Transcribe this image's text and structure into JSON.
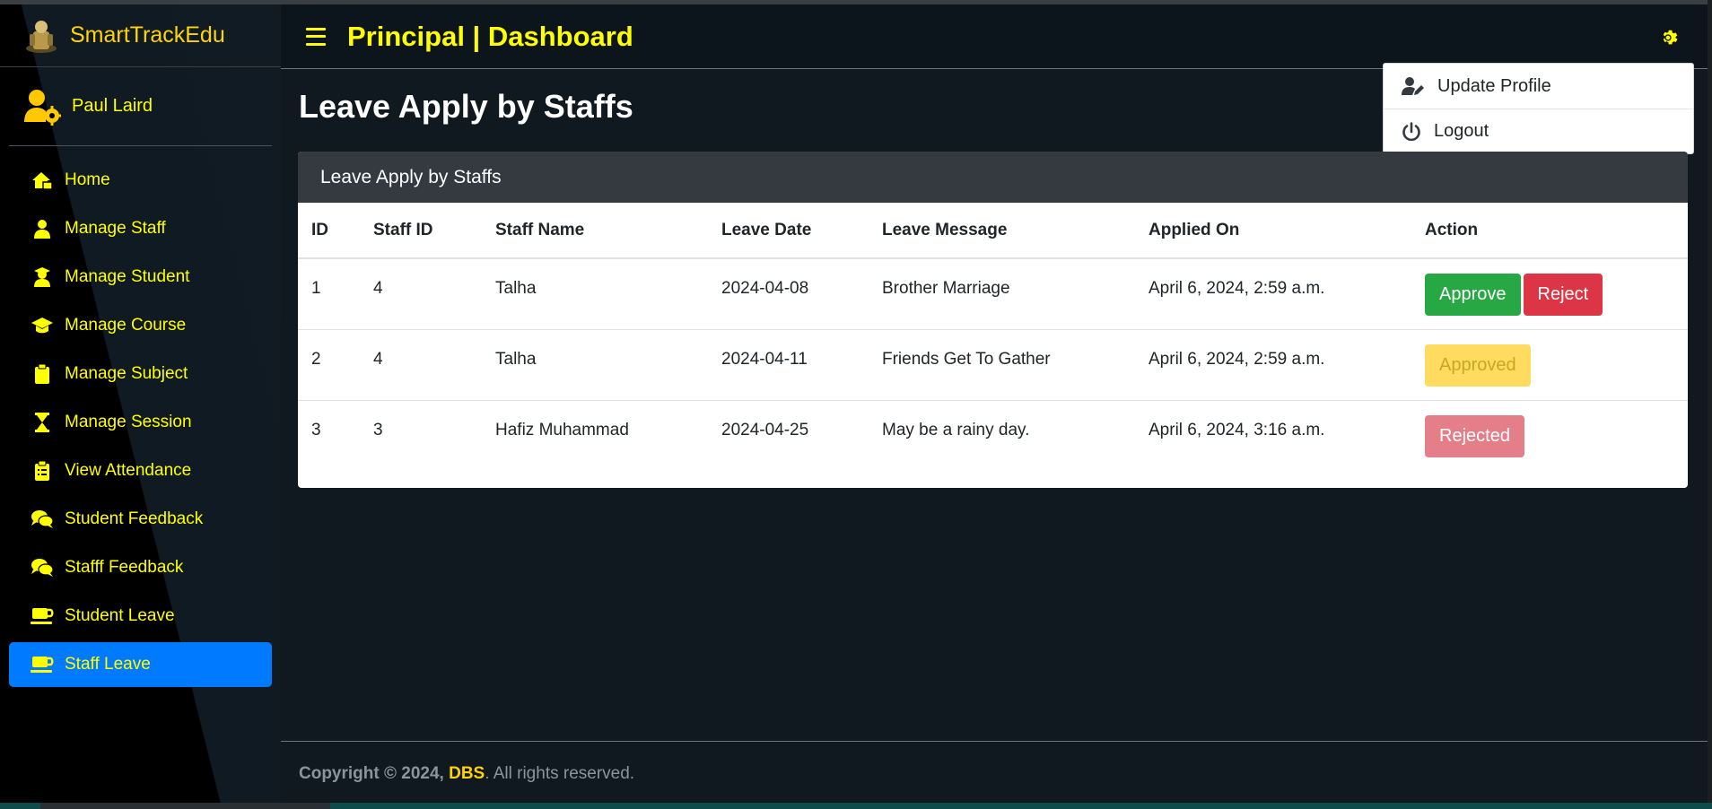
{
  "brand": {
    "name": "SmartTrackEdu"
  },
  "user": {
    "name": "Paul Laird"
  },
  "sidebar": {
    "items": [
      {
        "label": "Home",
        "icon": "home-icon"
      },
      {
        "label": "Manage Staff",
        "icon": "user-icon"
      },
      {
        "label": "Manage Student",
        "icon": "student-icon"
      },
      {
        "label": "Manage Course",
        "icon": "graduation-cap-icon"
      },
      {
        "label": "Manage Subject",
        "icon": "clipboard-icon"
      },
      {
        "label": "Manage Session",
        "icon": "hourglass-icon"
      },
      {
        "label": "View Attendance",
        "icon": "clipboard-list-icon"
      },
      {
        "label": "Student Feedback",
        "icon": "comments-icon"
      },
      {
        "label": "Stafff Feedback",
        "icon": "comments-icon"
      },
      {
        "label": "Student Leave",
        "icon": "coffee-icon"
      },
      {
        "label": "Staff Leave",
        "icon": "coffee-icon",
        "active": true
      }
    ]
  },
  "header": {
    "title": "Principal | Dashboard"
  },
  "dropdown": {
    "update_profile": "Update Profile",
    "logout": "Logout"
  },
  "main": {
    "title": "Leave Apply by Staffs",
    "card_title": "Leave Apply by Staffs",
    "columns": [
      "ID",
      "Staff ID",
      "Staff Name",
      "Leave Date",
      "Leave Message",
      "Applied On",
      "Action"
    ],
    "rows": [
      {
        "id": "1",
        "staff_id": "4",
        "staff_name": "Talha",
        "leave_date": "2024-04-08",
        "message": "Brother Marriage",
        "applied_on": "April 6, 2024, 2:59 a.m.",
        "approve": "Approve",
        "reject": "Reject"
      },
      {
        "id": "2",
        "staff_id": "4",
        "staff_name": "Talha",
        "leave_date": "2024-04-11",
        "message": "Friends Get To Gather",
        "applied_on": "April 6, 2024, 2:59 a.m.",
        "status": "Approved"
      },
      {
        "id": "3",
        "staff_id": "3",
        "staff_name": "Hafiz Muhammad",
        "leave_date": "2024-04-25",
        "message": "May be a rainy day.",
        "applied_on": "April 6, 2024, 3:16 a.m.",
        "status": "Rejected"
      }
    ]
  },
  "footer": {
    "prefix": "Copyright © 2024,",
    "company": "DBS",
    "suffix": ". All rights reserved."
  },
  "colors": {
    "accent": "#ffff00",
    "active": "#007bff",
    "approve": "#28a745",
    "reject": "#dc3545"
  }
}
